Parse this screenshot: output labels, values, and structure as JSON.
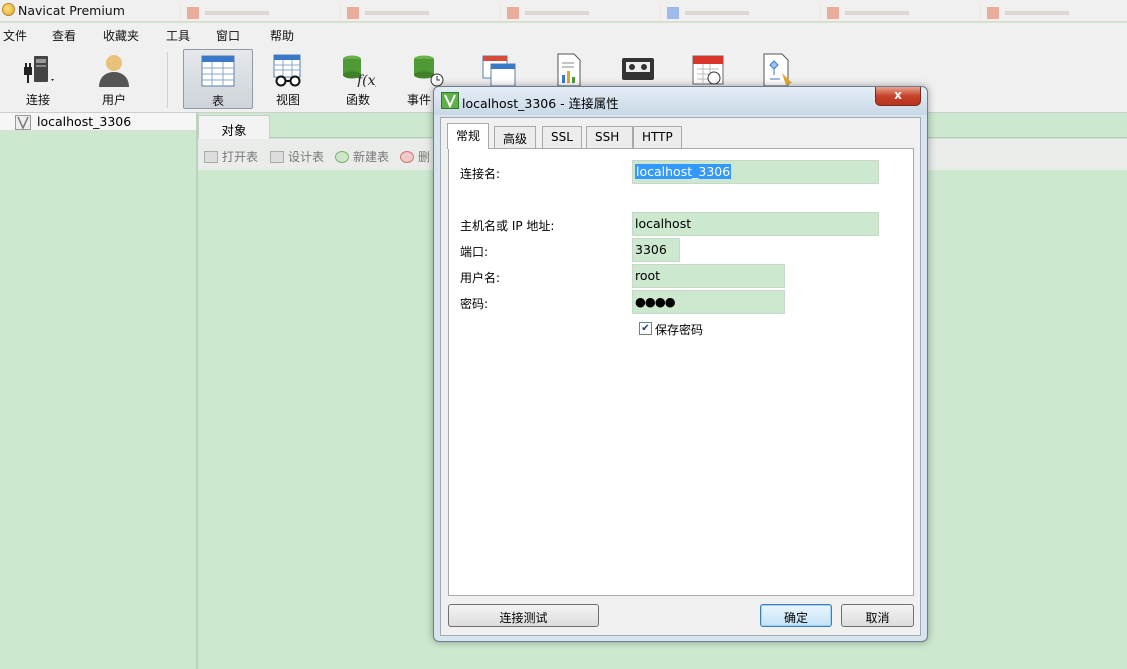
{
  "app": {
    "title": "Navicat Premium"
  },
  "menu": {
    "items": [
      "文件",
      "查看",
      "收藏夹",
      "工具",
      "窗口",
      "帮助"
    ]
  },
  "toolbar": {
    "connect": "连接",
    "user": "用户",
    "table": "表",
    "view": "视图",
    "function": "函数",
    "event": "事件"
  },
  "sidebar": {
    "connection": "localhost_3306"
  },
  "objects": {
    "tab": "对象",
    "open_table": "打开表",
    "design_table": "设计表",
    "new_table": "新建表",
    "delete_table": "删"
  },
  "dialog": {
    "title": "localhost_3306 - 连接属性",
    "close": "x",
    "tabs": [
      "常规",
      "高级",
      "SSL",
      "SSH",
      "HTTP"
    ],
    "fields": {
      "conn_name_label": "连接名:",
      "conn_name_value": "localhost_3306",
      "host_label": "主机名或 IP 地址:",
      "host_value": "localhost",
      "port_label": "端口:",
      "port_value": "3306",
      "user_label": "用户名:",
      "user_value": "root",
      "password_label": "密码:",
      "password_value": "●●●●",
      "save_password_label": "保存密码",
      "save_password_checked": true
    },
    "buttons": {
      "test": "连接测试",
      "ok": "确定",
      "cancel": "取消"
    }
  },
  "colors": {
    "background": "#cce8cf",
    "dialog_frame": "#d8e4ee",
    "selection": "#3399ff"
  }
}
